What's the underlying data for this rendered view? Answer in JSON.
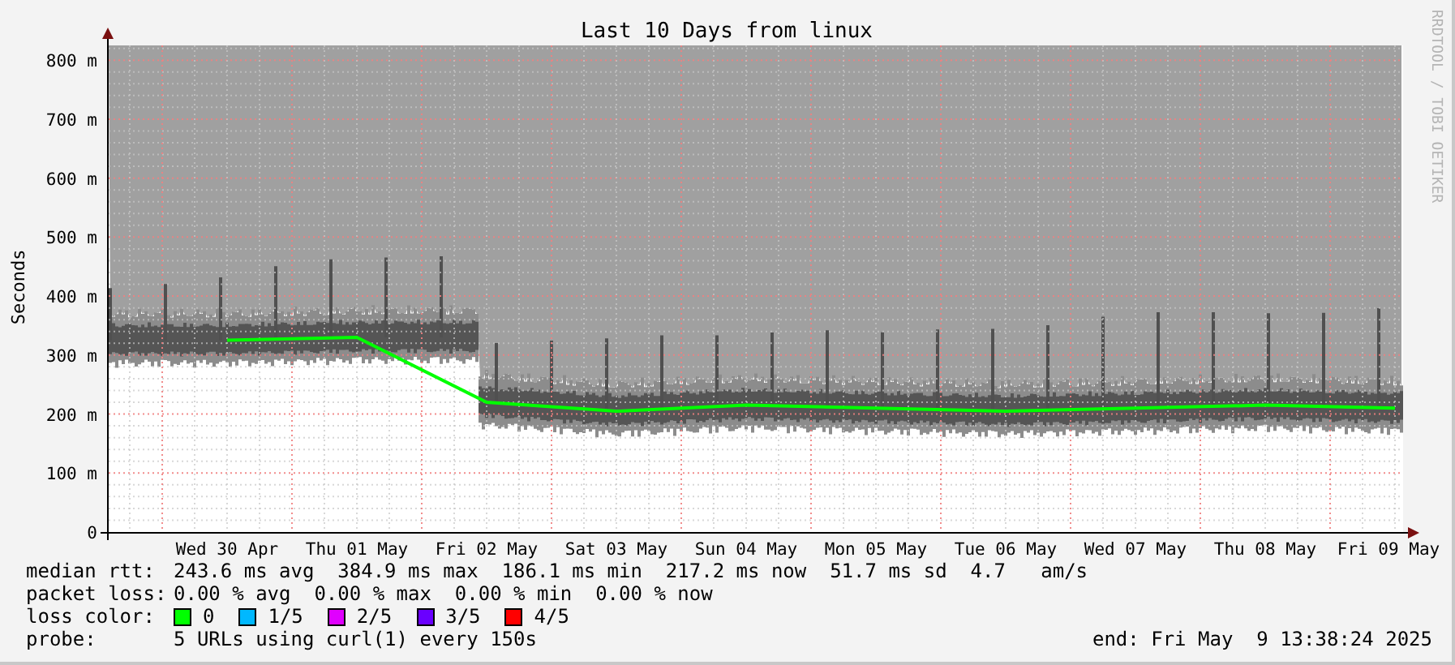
{
  "graph": {
    "watermark": "RRDTOOL / TOBI OETIKER",
    "chart_data": {
      "type": "line",
      "title": "Last 10 Days from linux",
      "ylabel": "Seconds",
      "categories": [
        "Wed 30 Apr",
        "Thu 01 May",
        "Fri 02 May",
        "Sat 03 May",
        "Sun 04 May",
        "Mon 05 May",
        "Tue 06 May",
        "Wed 07 May",
        "Thu 08 May",
        "Fri 09 May"
      ],
      "series": [
        {
          "color": "#00ff00",
          "values": [
            325,
            330,
            220,
            205,
            215,
            210,
            205,
            210,
            215,
            210
          ]
        }
      ],
      "ylim": [
        0,
        825
      ],
      "grid": true,
      "yticks": [
        {
          "value": 0,
          "label": "0"
        },
        {
          "value": 100,
          "label": "100 m"
        },
        {
          "value": 200,
          "label": "200 m"
        },
        {
          "value": 300,
          "label": "300 m"
        },
        {
          "value": 400,
          "label": "400 m"
        },
        {
          "value": 500,
          "label": "500 m"
        },
        {
          "value": 600,
          "label": "600 m"
        },
        {
          "value": 700,
          "label": "700 m"
        },
        {
          "value": 800,
          "label": "800 m"
        }
      ]
    }
  },
  "legend": {
    "median_rtt": {
      "label": "median rtt:",
      "text": "243.6 ms avg  384.9 ms max  186.1 ms min  217.2 ms now  51.7 ms sd  4.7   am/s"
    },
    "packet_loss": {
      "label": "packet loss:",
      "text": "0.00 % avg  0.00 % max  0.00 % min  0.00 % now"
    },
    "loss_color": {
      "label": "loss color:",
      "items": [
        {
          "label": "0",
          "color": "#00ff00"
        },
        {
          "label": "1/5",
          "color": "#00b8ff"
        },
        {
          "label": "2/5",
          "color": "#e000ff"
        },
        {
          "label": "3/5",
          "color": "#6a00ff"
        },
        {
          "label": "4/5",
          "color": "#ff0000"
        }
      ]
    },
    "probe": {
      "label": "probe:",
      "text": "5 URLs using curl(1) every 150s"
    },
    "end": "end: Fri May  9 13:38:24 2025"
  }
}
